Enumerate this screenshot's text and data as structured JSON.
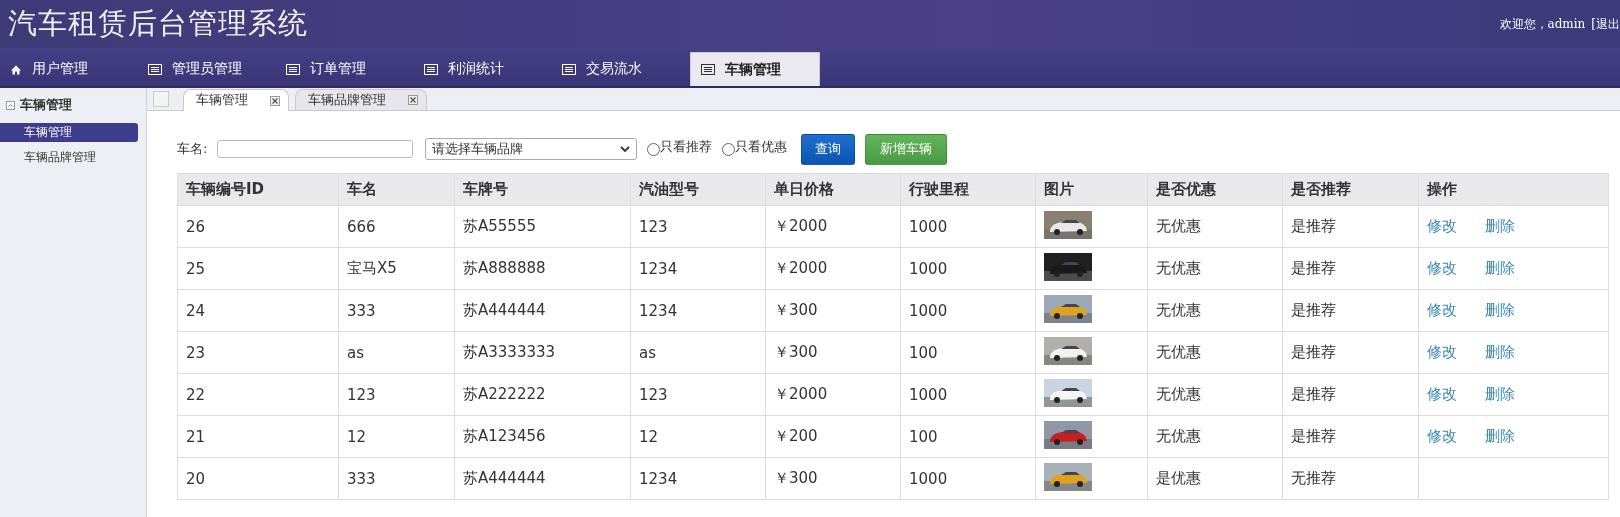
{
  "header": {
    "title": "汽车租赁后台管理系统",
    "welcome": "欢迎您，admin",
    "logout": "[退出"
  },
  "nav": [
    {
      "label": "用户管理",
      "kind": "home",
      "selected": false
    },
    {
      "label": "管理员管理",
      "kind": "list",
      "selected": false
    },
    {
      "label": "订单管理",
      "kind": "list",
      "selected": false
    },
    {
      "label": "利润统计",
      "kind": "list",
      "selected": false
    },
    {
      "label": "交易流水",
      "kind": "list",
      "selected": false
    },
    {
      "label": "车辆管理",
      "kind": "list",
      "selected": true
    }
  ],
  "sidebar": {
    "title": "车辆管理",
    "expanded": true,
    "items": [
      {
        "label": "车辆管理",
        "selected": true
      },
      {
        "label": "车辆品牌管理",
        "selected": false
      }
    ]
  },
  "tabs": [
    {
      "label": "车辆管理",
      "selected": true
    },
    {
      "label": "车辆品牌管理",
      "selected": false
    }
  ],
  "filters": {
    "name_label": "车名:",
    "brand_placeholder": "请选择车辆品牌",
    "options": [
      {
        "label": "只看推荐",
        "checked": false
      },
      {
        "label": "只看优惠",
        "checked": false
      }
    ],
    "buttons": [
      {
        "label": "查询",
        "kind": "primary"
      },
      {
        "label": "新增车辆",
        "kind": "success"
      }
    ]
  },
  "table": {
    "columns": [
      "车辆编号ID",
      "车名",
      "车牌号",
      "汽油型号",
      "单日价格",
      "行驶里程",
      "图片",
      "是否优惠",
      "是否推荐",
      "操作"
    ],
    "rows": [
      {
        "cells": [
          "26",
          "666",
          "苏A55555",
          "123",
          "￥2000",
          "1000"
        ],
        "picture": {
          "kind": "picture"
        },
        "discount": "无优惠",
        "recommend": "是推荐",
        "actions": [
          "修改",
          "删除"
        ]
      },
      {
        "cells": [
          "25",
          "宝马X5",
          "苏A888888",
          "1234",
          "￥2000",
          "1000"
        ],
        "picture": {
          "kind": "picture"
        },
        "discount": "无优惠",
        "recommend": "是推荐",
        "actions": [
          "修改",
          "删除"
        ]
      },
      {
        "cells": [
          "24",
          "333",
          "苏A444444",
          "1234",
          "￥300",
          "1000"
        ],
        "picture": {
          "kind": "picture"
        },
        "discount": "无优惠",
        "recommend": "是推荐",
        "actions": [
          "修改",
          "删除"
        ]
      },
      {
        "cells": [
          "23",
          "as",
          "苏A3333333",
          "as",
          "￥300",
          "100"
        ],
        "picture": {
          "kind": "picture"
        },
        "discount": "无优惠",
        "recommend": "是推荐",
        "actions": [
          "修改",
          "删除"
        ]
      },
      {
        "cells": [
          "22",
          "123",
          "苏A222222",
          "123",
          "￥2000",
          "1000"
        ],
        "picture": {
          "kind": "picture"
        },
        "discount": "无优惠",
        "recommend": "是推荐",
        "actions": [
          "修改",
          "删除"
        ]
      },
      {
        "cells": [
          "21",
          "12",
          "苏A123456",
          "12",
          "￥200",
          "100"
        ],
        "picture": {
          "kind": "picture"
        },
        "discount": "无优惠",
        "recommend": "是推荐",
        "actions": [
          "修改",
          "删除"
        ]
      },
      {
        "cells": [
          "20",
          "333",
          "苏A444444",
          "1234",
          "￥300",
          "1000"
        ],
        "picture": {
          "kind": "picture"
        },
        "discount": "是优惠",
        "recommend": "无推荐"
      }
    ]
  }
}
